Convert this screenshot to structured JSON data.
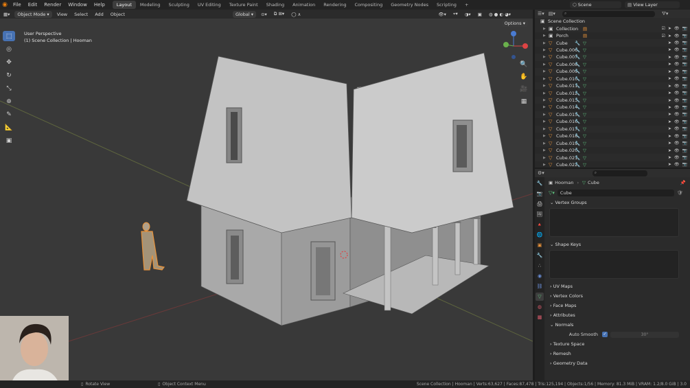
{
  "app": {
    "menu": [
      "File",
      "Edit",
      "Render",
      "Window",
      "Help"
    ],
    "workspaces": [
      "Layout",
      "Modeling",
      "Sculpting",
      "UV Editing",
      "Texture Paint",
      "Shading",
      "Animation",
      "Rendering",
      "Compositing",
      "Geometry Nodes",
      "Scripting"
    ],
    "active_workspace": "Layout",
    "add_tab": "+",
    "scene": "Scene",
    "view_layer": "View Layer"
  },
  "viewport_header": {
    "mode": "Object Mode",
    "menus": [
      "View",
      "Select",
      "Add",
      "Object"
    ],
    "transform_orientation": "Global",
    "options": "Options"
  },
  "viewport": {
    "perspective_label": "User Perspective",
    "collection_label": "(1) Scene Collection | Hooman"
  },
  "outliner": {
    "root": "Scene Collection",
    "items": [
      {
        "name": "Collection",
        "type": "collection"
      },
      {
        "name": "Porch",
        "type": "collection"
      },
      {
        "name": "Cube",
        "type": "mesh"
      },
      {
        "name": "Cube.006",
        "type": "mesh"
      },
      {
        "name": "Cube.007",
        "type": "mesh"
      },
      {
        "name": "Cube.008",
        "type": "mesh"
      },
      {
        "name": "Cube.009",
        "type": "mesh"
      },
      {
        "name": "Cube.010",
        "type": "mesh"
      },
      {
        "name": "Cube.011",
        "type": "mesh"
      },
      {
        "name": "Cube.012",
        "type": "mesh"
      },
      {
        "name": "Cube.013",
        "type": "mesh"
      },
      {
        "name": "Cube.014",
        "type": "mesh"
      },
      {
        "name": "Cube.015",
        "type": "mesh"
      },
      {
        "name": "Cube.016",
        "type": "mesh"
      },
      {
        "name": "Cube.017",
        "type": "mesh"
      },
      {
        "name": "Cube.018",
        "type": "mesh"
      },
      {
        "name": "Cube.019",
        "type": "mesh"
      },
      {
        "name": "Cube.020",
        "type": "mesh"
      },
      {
        "name": "Cube.021",
        "type": "mesh"
      },
      {
        "name": "Cube.022",
        "type": "mesh"
      }
    ]
  },
  "properties": {
    "breadcrumb_object": "Hooman",
    "breadcrumb_data": "Cube",
    "mesh_name": "Cube",
    "panels": {
      "vertex_groups": "Vertex Groups",
      "shape_keys": "Shape Keys",
      "uv_maps": "UV Maps",
      "vertex_colors": "Vertex Colors",
      "face_maps": "Face Maps",
      "attributes": "Attributes",
      "normals": "Normals",
      "auto_smooth": "Auto Smooth",
      "auto_smooth_angle": "30°",
      "texture_space": "Texture Space",
      "remesh": "Remesh",
      "geometry_data": "Geometry Data"
    }
  },
  "statusbar": {
    "left": "Rotate View",
    "middle": "Object Context Menu",
    "right": "Scene Collection | Hooman | Verts:63,627 | Faces:87,478 | Tris:125,194 | Objects:1/56 | Memory: 81.3 MiB | VRAM: 1.2/8.0 GiB | 3.0"
  },
  "colors": {
    "accent": "#4772b3",
    "blender_orange": "#e87d0d",
    "collection_white": "#cfcfcf",
    "mesh_orange": "#e8923a",
    "mesh_data_green": "#5fc27e"
  }
}
